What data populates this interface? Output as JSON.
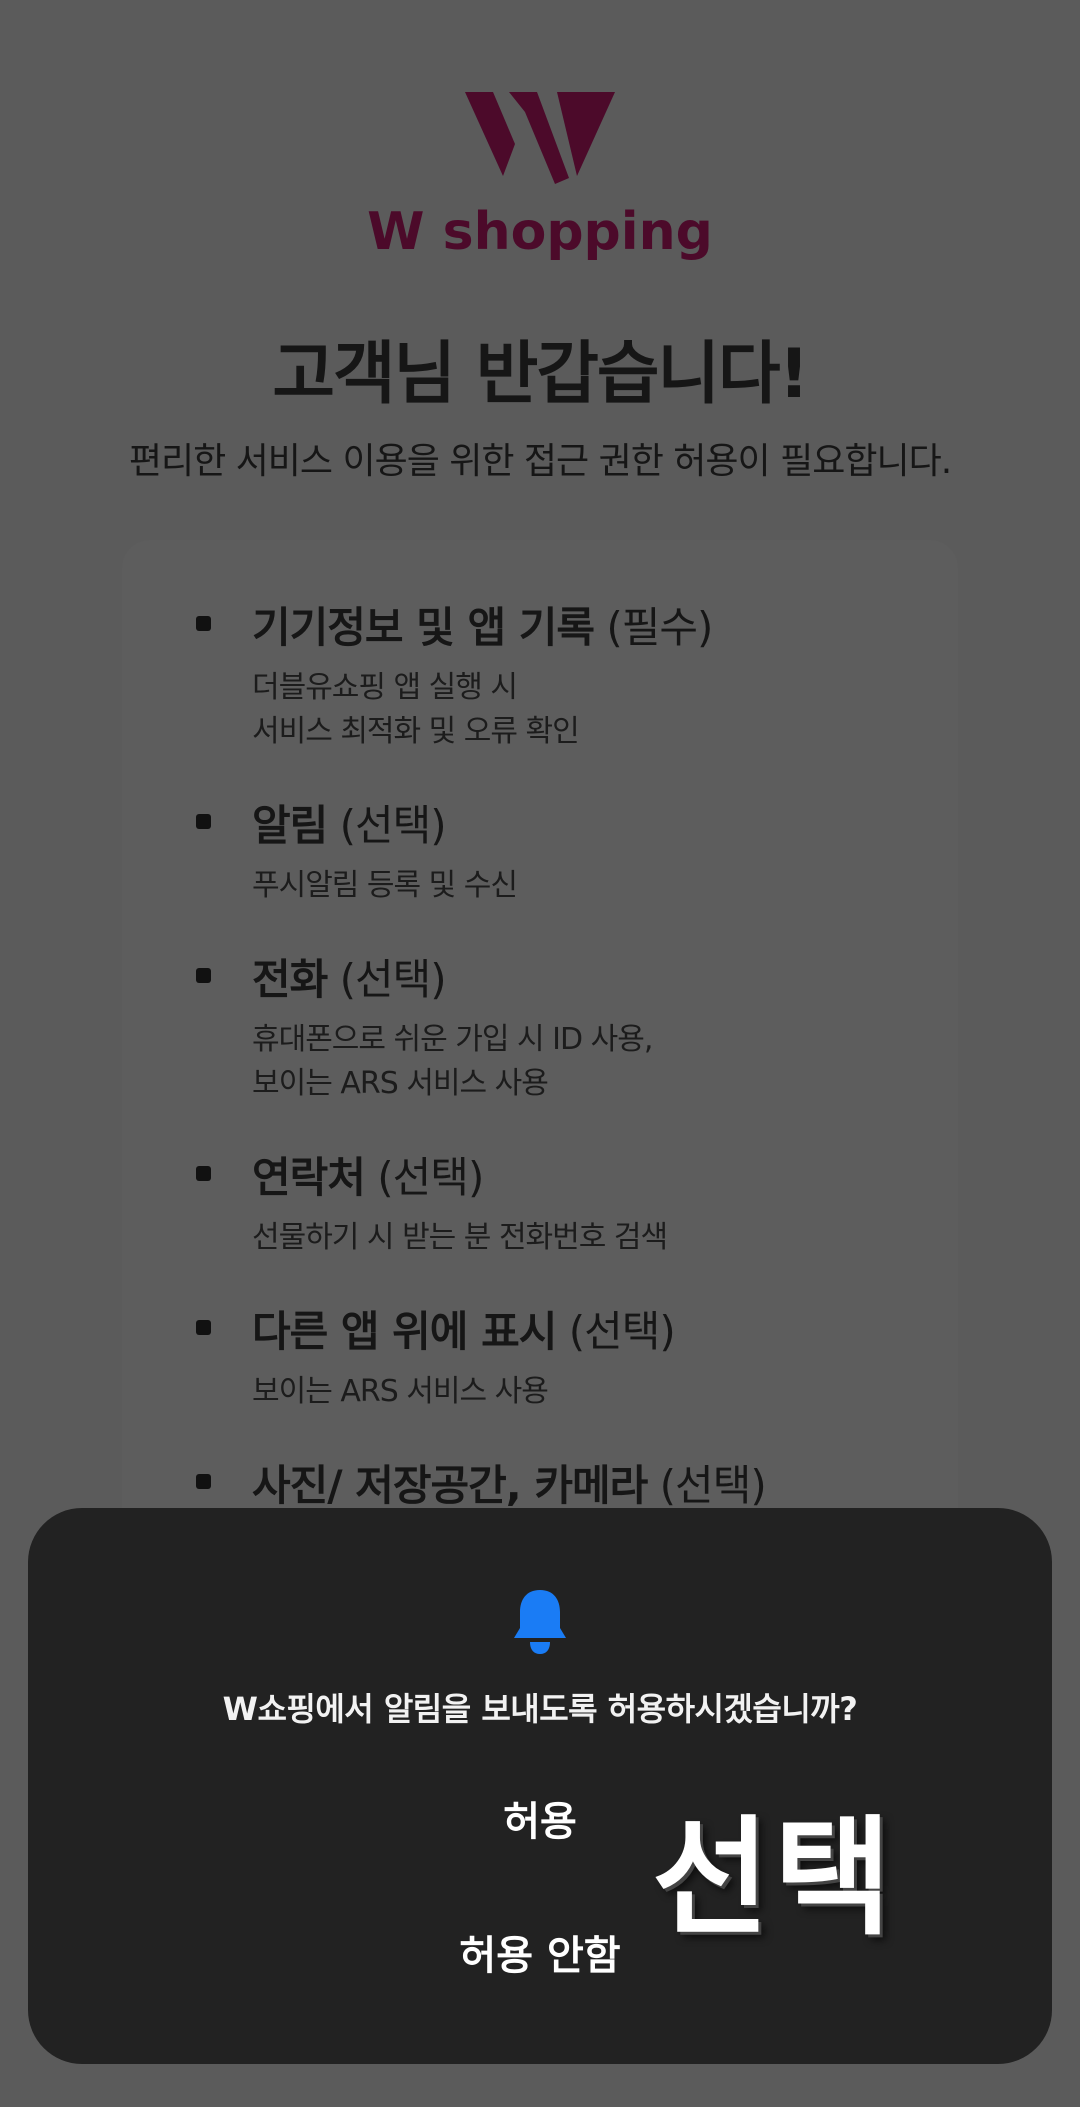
{
  "logo": {
    "text": "W shopping",
    "color": "#4c0a2a"
  },
  "header": {
    "title": "고객님 반갑습니다!",
    "subtitle": "편리한 서비스 이용을 위한 접근 권한 허용이 필요합니다."
  },
  "permissions": [
    {
      "name": "기기정보 및 앱 기록",
      "tag": "(필수)",
      "desc": [
        "더블유쇼핑 앱 실행 시",
        "서비스 최적화 및 오류 확인"
      ]
    },
    {
      "name": "알림",
      "tag": "(선택)",
      "desc": [
        "푸시알림 등록 및 수신"
      ]
    },
    {
      "name": "전화",
      "tag": "(선택)",
      "desc": [
        "휴대폰으로 쉬운 가입 시 ID 사용,",
        "보이는 ARS 서비스 사용"
      ]
    },
    {
      "name": "연락처",
      "tag": "(선택)",
      "desc": [
        "선물하기 시 받는 분 전화번호 검색"
      ]
    },
    {
      "name": "다른 앱 위에 표시",
      "tag": "(선택)",
      "desc": [
        "보이는 ARS 서비스 사용"
      ]
    },
    {
      "name": "사진/ 저장공간, 카메라",
      "tag": "(선택)",
      "desc": []
    }
  ],
  "dialog": {
    "icon": "bell-icon",
    "accent": "#1a7cf5",
    "message": "W쇼핑에서 알림을 보내도록 허용하시겠습니까?",
    "allow_label": "허용",
    "deny_label": "허용 안함"
  },
  "overlay_label": "선택"
}
